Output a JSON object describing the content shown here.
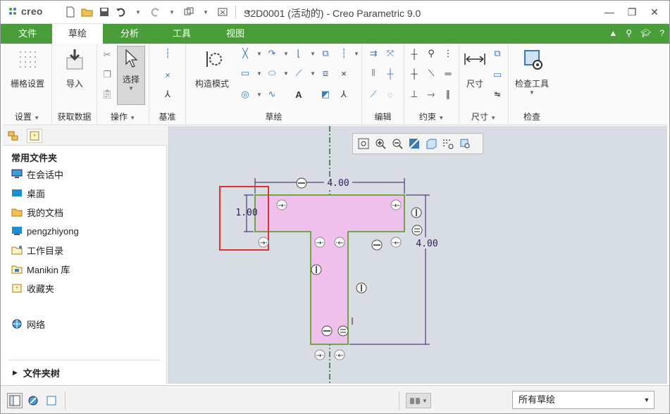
{
  "app": {
    "logo_text": "creo",
    "window_title": "S2D0001 (活动的) - Creo Parametric 9.0"
  },
  "tabs": {
    "file": "文件",
    "items": [
      "草绘",
      "分析",
      "工具",
      "视图"
    ],
    "active": "草绘"
  },
  "ribbon": {
    "groups": {
      "setup": "设置",
      "get_data": "获取数据",
      "operations": "操作",
      "datum": "基准",
      "sketch": "草绘",
      "edit": "编辑",
      "constrain": "约束",
      "dimension": "尺寸",
      "inspect": "检查"
    },
    "buttons": {
      "grid_settings": "栅格设置",
      "import": "导入",
      "select": "选择",
      "construction_mode": "构造模式",
      "dimension": "尺寸",
      "inspect_tools": "检查工具"
    }
  },
  "left_panel": {
    "heading": "常用文件夹",
    "items": [
      "在会话中",
      "桌面",
      "我的文档",
      "pengzhiyong",
      "工作目录",
      "Manikin 库",
      "收藏夹"
    ],
    "network": "网络",
    "folder_tree": "文件夹树"
  },
  "sketch": {
    "dims": {
      "top_width": "4.00",
      "right_height": "4.00",
      "flange_thickness": "1.00"
    }
  },
  "status": {
    "filter": "所有草绘"
  },
  "colors": {
    "ribbon_green": "#4a9e3a",
    "section_fill": "#f0c0ec",
    "section_edge": "#4a9a10",
    "highlight_box": "#e03030",
    "dim_line": "#2a1a6a"
  }
}
